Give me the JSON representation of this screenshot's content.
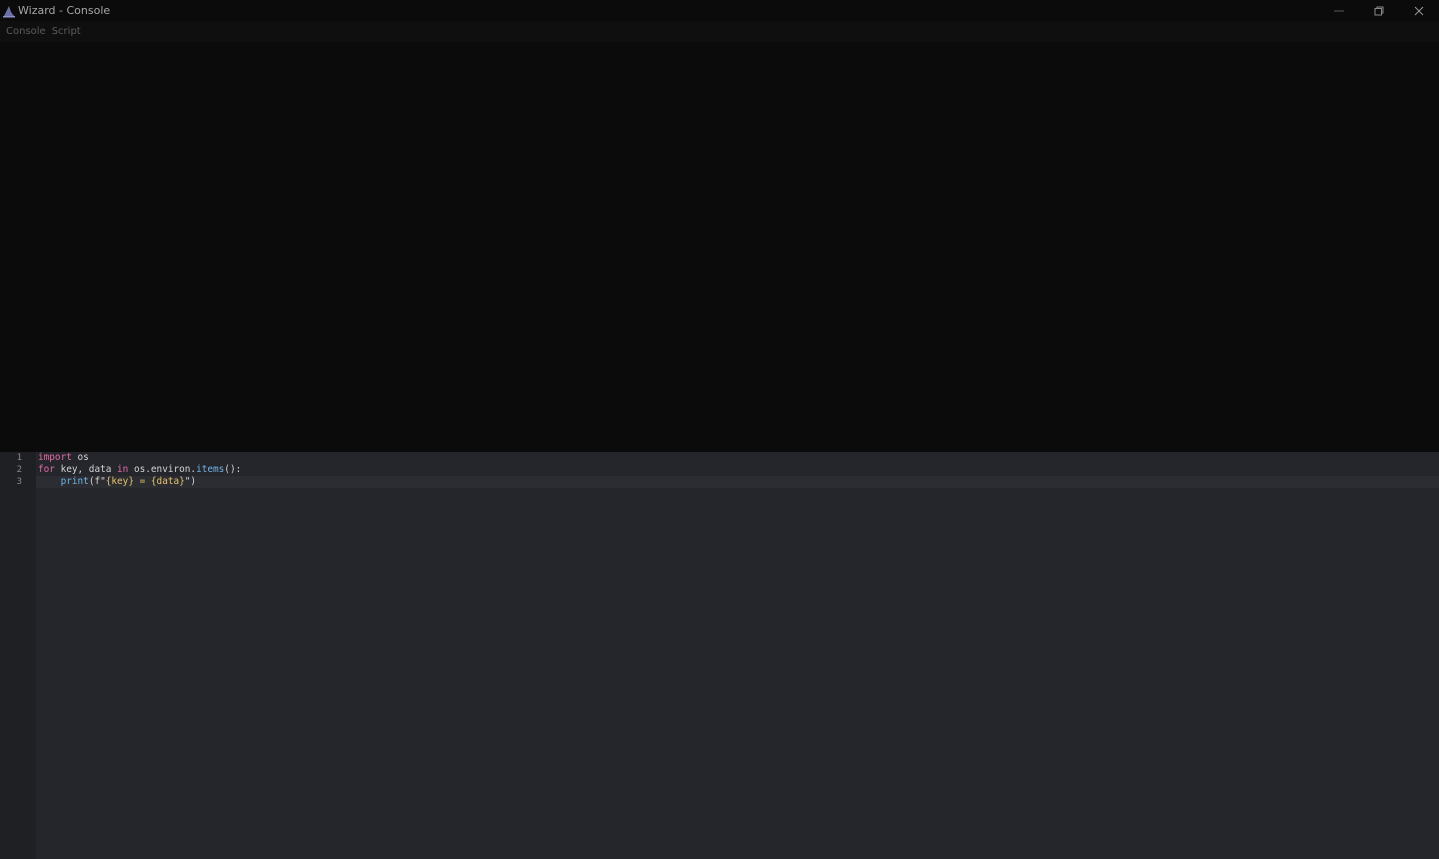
{
  "window": {
    "title": "Wizard - Console",
    "icon": "wizard-hat-icon"
  },
  "menu": {
    "items": [
      {
        "label": "Console"
      },
      {
        "label": "Script"
      }
    ]
  },
  "editor": {
    "line_numbers": [
      "1",
      "2",
      "3"
    ],
    "lines": [
      {
        "tokens": [
          {
            "t": "import",
            "k": "kw"
          },
          {
            "t": " os",
            "k": "plain"
          }
        ]
      },
      {
        "tokens": [
          {
            "t": "for",
            "k": "kw"
          },
          {
            "t": " key, data ",
            "k": "plain"
          },
          {
            "t": "in",
            "k": "kw"
          },
          {
            "t": " os.environ.",
            "k": "plain"
          },
          {
            "t": "items",
            "k": "fn"
          },
          {
            "t": "():",
            "k": "plain"
          }
        ]
      },
      {
        "tokens": [
          {
            "t": "    ",
            "k": "plain"
          },
          {
            "t": "print",
            "k": "fn"
          },
          {
            "t": "(f\"",
            "k": "plain"
          },
          {
            "t": "{key} = {data}",
            "k": "str"
          },
          {
            "t": "\")",
            "k": "plain"
          }
        ]
      }
    ],
    "current_line": 3
  },
  "colors": {
    "background": "#0b0b0b",
    "editor_bg": "#25262b",
    "gutter_bg": "#1f2024",
    "keyword": "#e06ca5",
    "function": "#6fb3e6",
    "string": "#e7c26a"
  }
}
